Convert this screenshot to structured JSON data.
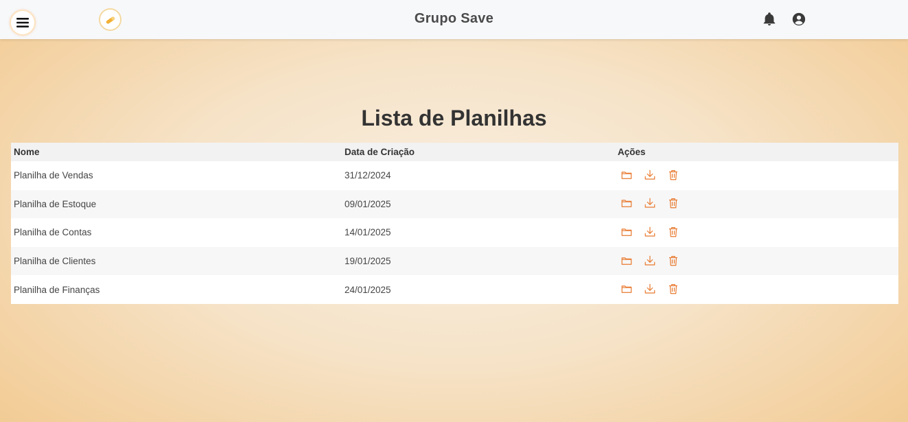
{
  "header": {
    "title": "Grupo Save",
    "menu_icon": "hamburger-menu-icon",
    "logo_icon": "pencil-logo-icon",
    "notification_icon": "bell-icon",
    "account_icon": "user-circle-icon"
  },
  "main": {
    "title": "Lista de Planilhas",
    "columns": [
      "Nome",
      "Data de Criação",
      "Ações"
    ],
    "rows": [
      {
        "name": "Planilha de Vendas",
        "date": "31/12/2024"
      },
      {
        "name": "Planilha de Estoque",
        "date": "09/01/2025"
      },
      {
        "name": "Planilha de Contas",
        "date": "14/01/2025"
      },
      {
        "name": "Planilha de Clientes",
        "date": "19/01/2025"
      },
      {
        "name": "Planilha de Finanças",
        "date": "24/01/2025"
      }
    ],
    "action_icons": [
      "folder-icon",
      "download-icon",
      "trash-icon"
    ]
  },
  "colors": {
    "accent": "#e8792e",
    "header_bg": "#f7f8fa",
    "bg_center": "#f9efe2",
    "bg_edge": "#f2c98f"
  }
}
